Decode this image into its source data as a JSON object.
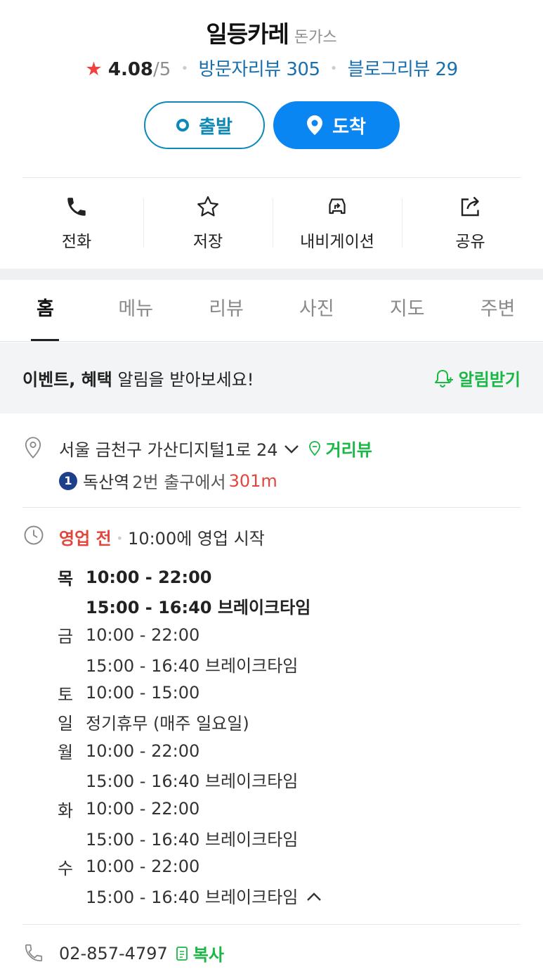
{
  "place": {
    "name": "일등카레",
    "category": "돈가스",
    "rating": "4.08",
    "rating_max": "/5",
    "visitor_reviews": "방문자리뷰 305",
    "blog_reviews": "블로그리뷰 29"
  },
  "route": {
    "start_label": "출발",
    "arrive_label": "도착"
  },
  "actions": [
    {
      "label": "전화",
      "icon": "phone-icon"
    },
    {
      "label": "저장",
      "icon": "star-outline-icon"
    },
    {
      "label": "내비게이션",
      "icon": "car-navigation-icon"
    },
    {
      "label": "공유",
      "icon": "share-icon"
    }
  ],
  "tabs": [
    {
      "label": "홈",
      "active": true
    },
    {
      "label": "메뉴",
      "active": false
    },
    {
      "label": "리뷰",
      "active": false
    },
    {
      "label": "사진",
      "active": false
    },
    {
      "label": "지도",
      "active": false
    },
    {
      "label": "주변",
      "active": false
    }
  ],
  "notice": {
    "bold_text": "이벤트, 혜택",
    "text": " 알림을 받아보세요!",
    "button_label": "알림받기"
  },
  "address": {
    "text": "서울 금천구 가산디지털1로 24",
    "roadview_label": "거리뷰"
  },
  "subway": {
    "line_number": "1",
    "station": "독산역",
    "exit_text": "2번 출구에서",
    "distance": "301m",
    "line_color": "#1e3f8a"
  },
  "hours": {
    "status": "영업 전",
    "status_desc": "10:00에 영업 시작",
    "schedule": [
      {
        "day": "목",
        "text": "10:00 - 22:00",
        "today": true
      },
      {
        "day": "",
        "text": "15:00 - 16:40 브레이크타임",
        "today": true
      },
      {
        "day": "금",
        "text": "10:00 - 22:00",
        "today": false
      },
      {
        "day": "",
        "text": "15:00 - 16:40 브레이크타임",
        "today": false
      },
      {
        "day": "토",
        "text": "10:00 - 15:00",
        "today": false
      },
      {
        "day": "일",
        "text": "정기휴무 (매주 일요일)",
        "today": false
      },
      {
        "day": "월",
        "text": "10:00 - 22:00",
        "today": false
      },
      {
        "day": "",
        "text": "15:00 - 16:40 브레이크타임",
        "today": false
      },
      {
        "day": "화",
        "text": "10:00 - 22:00",
        "today": false
      },
      {
        "day": "",
        "text": "15:00 - 16:40 브레이크타임",
        "today": false
      },
      {
        "day": "수",
        "text": "10:00 - 22:00",
        "today": false
      },
      {
        "day": "",
        "text": "15:00 - 16:40 브레이크타임",
        "today": false
      }
    ]
  },
  "phone": {
    "number": "02-857-4797",
    "copy_label": "복사"
  },
  "colors": {
    "accent_blue": "#0a86f3",
    "link_blue": "#1a6fae",
    "green": "#19b845",
    "red": "#e2453b",
    "star": "#f0413f"
  }
}
